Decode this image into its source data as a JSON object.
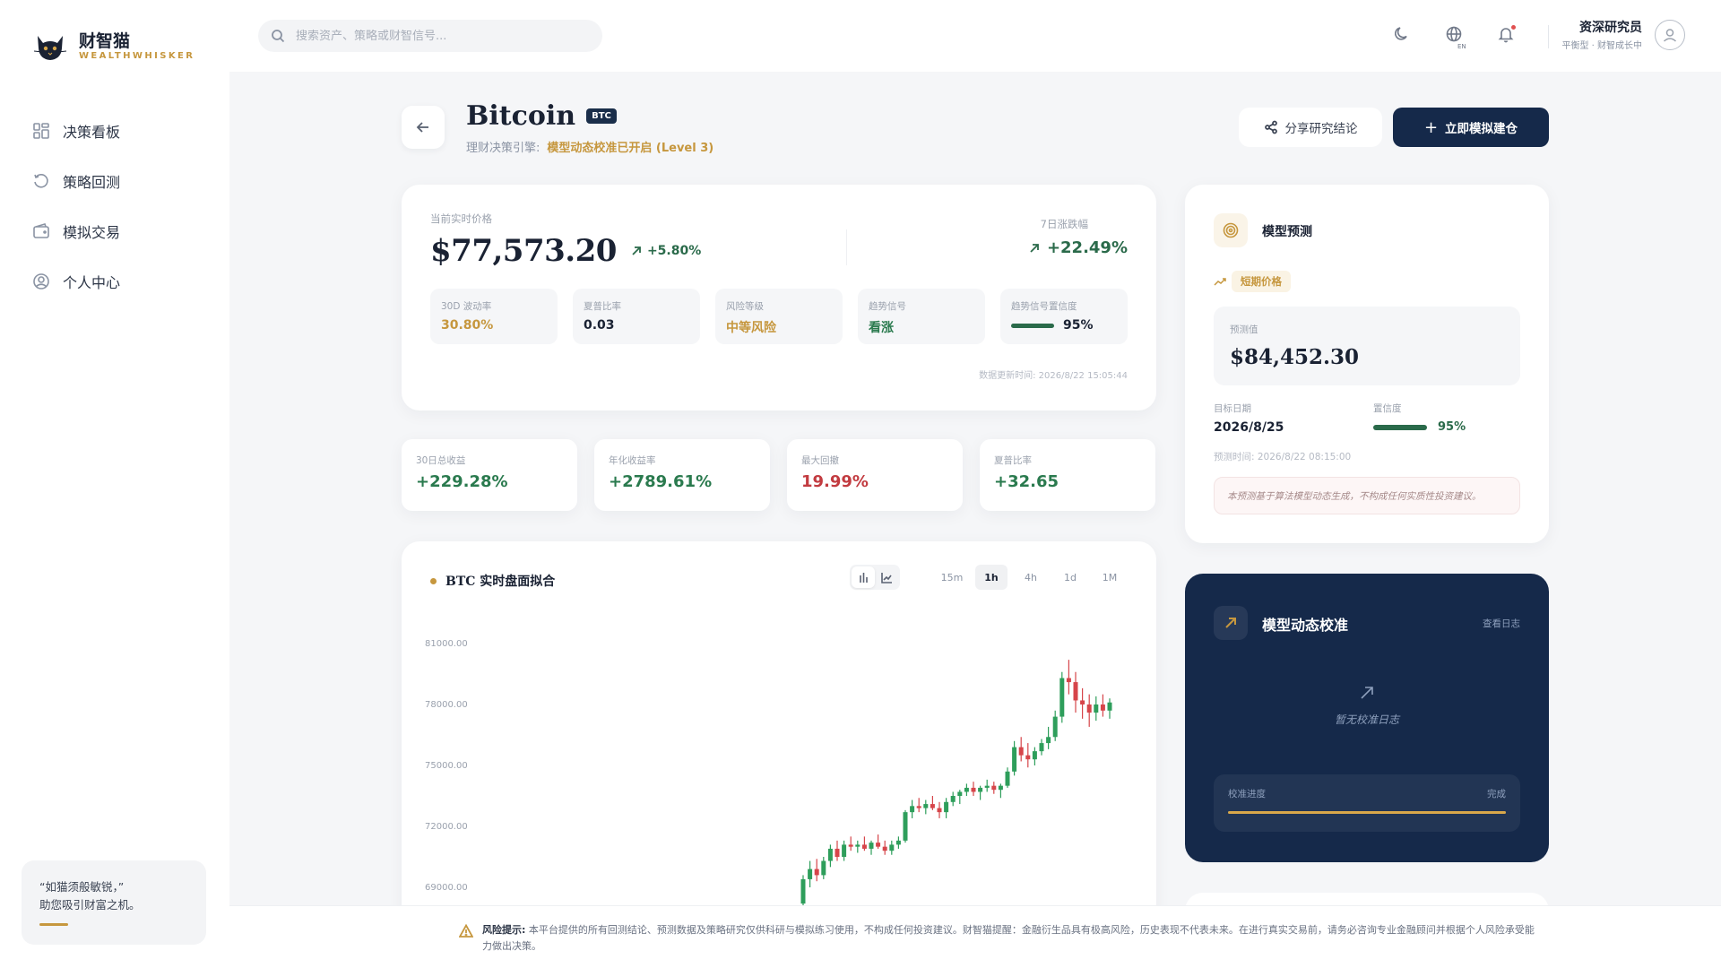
{
  "brand": {
    "name_cn": "财智猫",
    "name_en": "WEALTHWHISKER"
  },
  "nav": {
    "items": [
      {
        "label": "决策看板",
        "icon": "dashboard-icon"
      },
      {
        "label": "策略回测",
        "icon": "history-icon"
      },
      {
        "label": "模拟交易",
        "icon": "wallet-icon"
      },
      {
        "label": "个人中心",
        "icon": "user-circle-icon"
      }
    ]
  },
  "sidebar_quote": {
    "line1": "“如猫须般敏锐，”",
    "line2": "助您吸引财富之机。"
  },
  "search": {
    "placeholder": "搜索资产、策略或财智信号..."
  },
  "topbar": {
    "lang_badge": "EN"
  },
  "user": {
    "name": "资深研究员",
    "subtitle": "平衡型 · 财智成长中"
  },
  "asset": {
    "name": "Bitcoin",
    "badge": "BTC",
    "engine_label": "理财决策引擎:",
    "engine_status": "模型动态校准已开启 (Level 3)"
  },
  "actions": {
    "share": "分享研究结论",
    "simulate": "立即模拟建仓"
  },
  "price": {
    "label": "当前实时价格",
    "value": "$77,573.20",
    "change": "+5.80%",
    "week_label": "7日涨跌幅",
    "week_value": "+22.49%",
    "updated": "数据更新时间: 2026/8/22 15:05:44",
    "metrics": [
      {
        "label": "30D 波动率",
        "value": "30.80%"
      },
      {
        "label": "夏普比率",
        "value": "0.03"
      },
      {
        "label": "风险等级",
        "value": "中等风险"
      },
      {
        "label": "趋势信号",
        "value": "看涨"
      },
      {
        "label": "趋势信号置信度",
        "value": "95%",
        "level": 0.95
      }
    ]
  },
  "stats": [
    {
      "label": "30日总收益",
      "value": "+229.28%"
    },
    {
      "label": "年化收益率",
      "value": "+2789.61%"
    },
    {
      "label": "最大回撤",
      "value": "19.99%"
    },
    {
      "label": "夏普比率",
      "value": "+32.65"
    }
  ],
  "chart": {
    "title": "BTC 实时盘面拟合",
    "intervals": [
      "15m",
      "1h",
      "4h",
      "1d",
      "1M"
    ],
    "active_interval": "1h"
  },
  "chart_data": {
    "type": "candlestick",
    "yticks": [
      "81000.00",
      "78000.00",
      "75000.00",
      "72000.00",
      "69000.00"
    ],
    "ylim": [
      67500,
      82500
    ],
    "candles": [
      [
        68200,
        69600,
        67600,
        69400
      ],
      [
        69400,
        70300,
        69000,
        69900
      ],
      [
        69900,
        70400,
        69300,
        69600
      ],
      [
        69600,
        70500,
        69400,
        70300
      ],
      [
        70300,
        71100,
        70000,
        70900
      ],
      [
        70900,
        71300,
        70300,
        70500
      ],
      [
        70500,
        71300,
        70300,
        71100
      ],
      [
        71100,
        71500,
        70800,
        71000
      ],
      [
        71000,
        71300,
        70700,
        71100
      ],
      [
        71100,
        71500,
        70800,
        70900
      ],
      [
        70900,
        71300,
        70600,
        71200
      ],
      [
        71200,
        71600,
        70900,
        71000
      ],
      [
        71000,
        71300,
        70600,
        70800
      ],
      [
        70800,
        71300,
        70600,
        71100
      ],
      [
        71100,
        71500,
        70900,
        71300
      ],
      [
        71300,
        72800,
        71200,
        72700
      ],
      [
        72700,
        73300,
        72400,
        73000
      ],
      [
        73000,
        73400,
        72700,
        72900
      ],
      [
        72900,
        73300,
        72600,
        73100
      ],
      [
        73100,
        73500,
        72800,
        72900
      ],
      [
        72900,
        73200,
        72400,
        72700
      ],
      [
        72700,
        73400,
        72400,
        73200
      ],
      [
        73200,
        73700,
        73000,
        73500
      ],
      [
        73500,
        73800,
        73100,
        73700
      ],
      [
        73700,
        74100,
        73500,
        73900
      ],
      [
        73900,
        74200,
        73500,
        73700
      ],
      [
        73700,
        74000,
        73300,
        73900
      ],
      [
        73900,
        74300,
        73700,
        74000
      ],
      [
        74000,
        74200,
        73600,
        73800
      ],
      [
        73800,
        74100,
        73400,
        74000
      ],
      [
        74000,
        74900,
        73900,
        74700
      ],
      [
        74700,
        76200,
        74500,
        75900
      ],
      [
        75900,
        76400,
        75200,
        75500
      ],
      [
        75500,
        76100,
        74900,
        75300
      ],
      [
        75300,
        75900,
        75000,
        75700
      ],
      [
        75700,
        76300,
        75500,
        76100
      ],
      [
        76100,
        76900,
        75800,
        76400
      ],
      [
        76400,
        77700,
        76200,
        77400
      ],
      [
        77400,
        79600,
        77100,
        79300
      ],
      [
        79300,
        80200,
        78500,
        79100
      ],
      [
        79100,
        79600,
        77600,
        78200
      ],
      [
        78200,
        78800,
        77300,
        78000
      ],
      [
        78000,
        78500,
        76900,
        77600
      ],
      [
        77600,
        78400,
        77200,
        78000
      ],
      [
        78000,
        78500,
        77400,
        77700
      ],
      [
        77700,
        78300,
        77300,
        78100
      ]
    ]
  },
  "forecast": {
    "title": "模型预测",
    "tag": "短期价格",
    "value_label": "预测值",
    "value": "$84,452.30",
    "date_label": "目标日期",
    "date": "2026/8/25",
    "conf_label": "置信度",
    "conf": "95%",
    "conf_level": 0.95,
    "time": "预测时间: 2026/8/22 08:15:00",
    "disclaimer": "本预测基于算法模型动态生成，不构成任何实质性投资建议。"
  },
  "calibration": {
    "title": "模型动态校准",
    "log_link": "查看日志",
    "empty": "暂无校准日志",
    "progress_label": "校准进度",
    "progress_status": "完成",
    "progress": 1.0
  },
  "risk": {
    "label": "风险提示:",
    "text": "本平台提供的所有回测结论、预测数据及策略研究仅供科研与模拟练习使用，不构成任何投资建议。财智猫提醒：金融衍生品具有极高风险，历史表现不代表未来。在进行真实交易前，请务必咨询专业金融顾问并根据个人风险承受能力做出决策。"
  },
  "colors": {
    "navy": "#15294a",
    "gold": "#c6973e",
    "green": "#2a7a4e",
    "red": "#c23b40",
    "candle_up": "#2e9e5b",
    "candle_down": "#d6454a"
  }
}
